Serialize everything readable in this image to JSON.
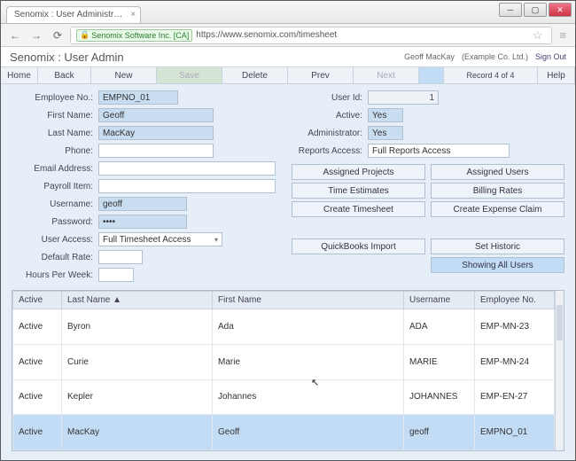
{
  "browser": {
    "tab_title": "Senomix : User Administr…",
    "cert_label": "Senomix Software Inc. [CA]",
    "url": "https://www.senomix.com/timesheet"
  },
  "header": {
    "title": "Senomix : User Admin",
    "user_name": "Geoff MacKay",
    "company": "(Example Co. Ltd.)",
    "sign_out": "Sign Out"
  },
  "toolbar": {
    "home": "Home",
    "back": "Back",
    "new": "New",
    "save": "Save",
    "delete": "Delete",
    "prev": "Prev",
    "next": "Next",
    "record": "Record 4 of 4",
    "help": "Help"
  },
  "form": {
    "left": {
      "employee_no_label": "Employee No.:",
      "employee_no": "EMPNO_01",
      "first_name_label": "First Name:",
      "first_name": "Geoff",
      "last_name_label": "Last Name:",
      "last_name": "MacKay",
      "phone_label": "Phone:",
      "phone": "",
      "email_label": "Email Address:",
      "email": "",
      "payroll_label": "Payroll Item:",
      "payroll": "",
      "username_label": "Username:",
      "username": "geoff",
      "password_label": "Password:",
      "password": "••••",
      "user_access_label": "User Access:",
      "user_access": "Full Timesheet Access",
      "default_rate_label": "Default Rate:",
      "default_rate": "",
      "hpw_label": "Hours Per Week:",
      "hpw": ""
    },
    "right": {
      "user_id_label": "User Id:",
      "user_id": "1",
      "active_label": "Active:",
      "active": "Yes",
      "admin_label": "Administrator:",
      "admin": "Yes",
      "reports_label": "Reports Access:",
      "reports": "Full Reports Access"
    },
    "buttons": {
      "assigned_projects": "Assigned Projects",
      "assigned_users": "Assigned Users",
      "time_estimates": "Time Estimates",
      "billing_rates": "Billing Rates",
      "create_timesheet": "Create Timesheet",
      "create_expense": "Create Expense Claim",
      "quickbooks": "QuickBooks Import",
      "set_historic": "Set Historic",
      "showing_all": "Showing All Users"
    }
  },
  "grid": {
    "headers": {
      "active": "Active",
      "last_name": "Last Name ▲",
      "first_name": "First Name",
      "username": "Username",
      "employee_no": "Employee No."
    },
    "rows": [
      {
        "active": "Active",
        "last": "Byron",
        "first": "Ada",
        "user": "ADA",
        "emp": "EMP-MN-23"
      },
      {
        "active": "Active",
        "last": "Curie",
        "first": "Marie",
        "user": "MARIE",
        "emp": "EMP-MN-24"
      },
      {
        "active": "Active",
        "last": "Kepler",
        "first": "Johannes",
        "user": "JOHANNES",
        "emp": "EMP-EN-27"
      },
      {
        "active": "Active",
        "last": "MacKay",
        "first": "Geoff",
        "user": "geoff",
        "emp": "EMPNO_01"
      }
    ],
    "selected_index": 3
  }
}
